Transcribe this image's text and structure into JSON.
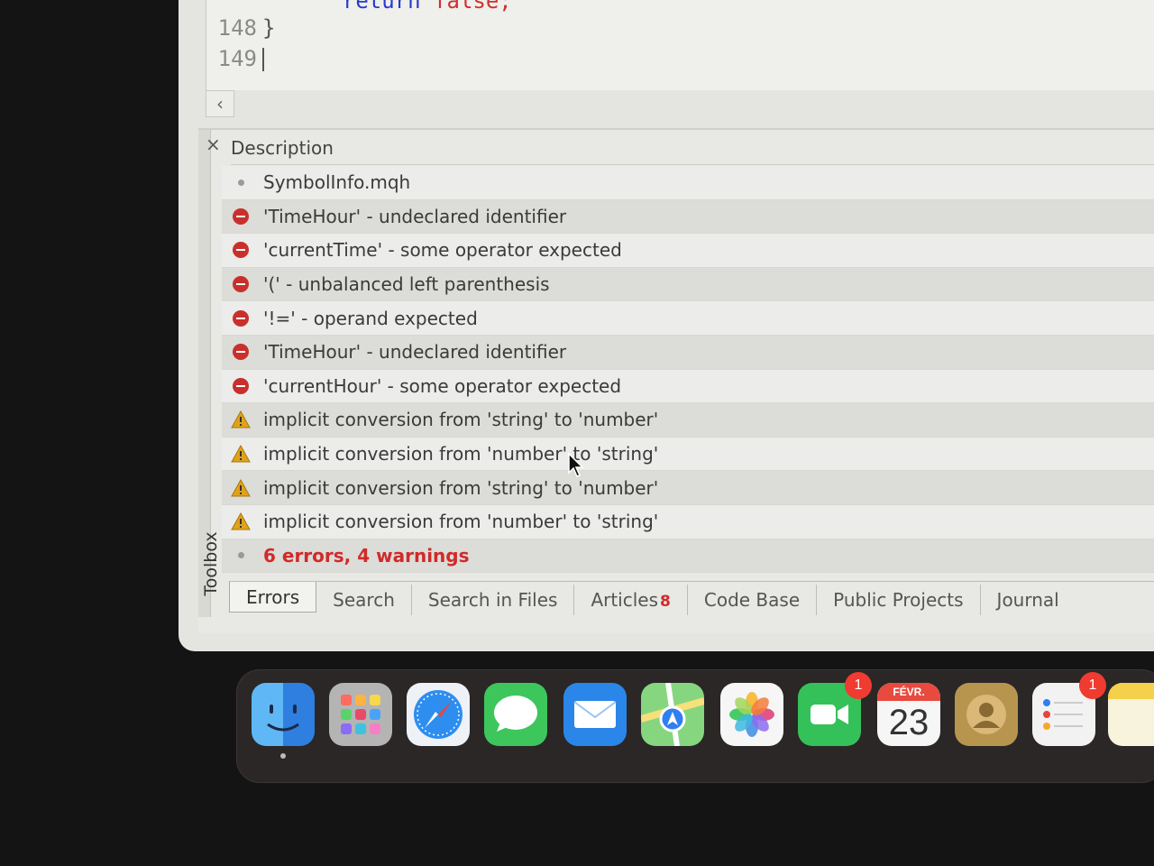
{
  "editor": {
    "lines": [
      {
        "number": "148",
        "text": "}"
      },
      {
        "number": "149",
        "text": ""
      }
    ],
    "partial_top_code": {
      "keyword": "return",
      "literal": "false;"
    }
  },
  "toolbox": {
    "side_label": "Toolbox",
    "close_glyph": "×",
    "column_header": "Description",
    "rows": [
      {
        "type": "info",
        "text": "SymbolInfo.mqh"
      },
      {
        "type": "error",
        "text": "'TimeHour' - undeclared identifier"
      },
      {
        "type": "error",
        "text": "'currentTime' - some operator expected"
      },
      {
        "type": "error",
        "text": "'(' - unbalanced left parenthesis"
      },
      {
        "type": "error",
        "text": "'!=' - operand expected"
      },
      {
        "type": "error",
        "text": "'TimeHour' - undeclared identifier"
      },
      {
        "type": "error",
        "text": "'currentHour' - some operator expected"
      },
      {
        "type": "warning",
        "text": "implicit conversion from 'string' to 'number'"
      },
      {
        "type": "warning",
        "text": "implicit conversion from 'number' to 'string'"
      },
      {
        "type": "warning",
        "text": "implicit conversion from 'string' to 'number'"
      },
      {
        "type": "warning",
        "text": "implicit conversion from 'number' to 'string'"
      },
      {
        "type": "summary",
        "text": "6 errors, 4 warnings"
      }
    ],
    "tabs": [
      {
        "label": "Errors",
        "active": true
      },
      {
        "label": "Search"
      },
      {
        "label": "Search in Files"
      },
      {
        "label": "Articles",
        "badge": "8"
      },
      {
        "label": "Code Base"
      },
      {
        "label": "Public Projects"
      },
      {
        "label": "Journal"
      }
    ]
  },
  "dock": {
    "apps": [
      {
        "name": "Finder",
        "color": "#2f8fe8"
      },
      {
        "name": "Launchpad",
        "color": "#b9b9b9"
      },
      {
        "name": "Safari",
        "color": "#e9eef5"
      },
      {
        "name": "Messages",
        "color": "#34c45a"
      },
      {
        "name": "Mail",
        "color": "#2a86e8"
      },
      {
        "name": "Maps",
        "color": "#7fd17c"
      },
      {
        "name": "Photos",
        "color": "#f4f4f4"
      },
      {
        "name": "FaceTime",
        "color": "#2fbd52",
        "badge": "1"
      },
      {
        "name": "Calendar",
        "color": "#f6f6f6",
        "month": "FÉVR.",
        "day": "23"
      },
      {
        "name": "Contacts",
        "color": "#b8954f"
      },
      {
        "name": "Reminders",
        "color": "#f2f2f2",
        "badge": "1"
      },
      {
        "name": "Notes",
        "color": "#f5d04a"
      }
    ]
  },
  "colors": {
    "error": "#c9302c",
    "warning": "#e0a21a",
    "summary": "#d02a2a"
  }
}
